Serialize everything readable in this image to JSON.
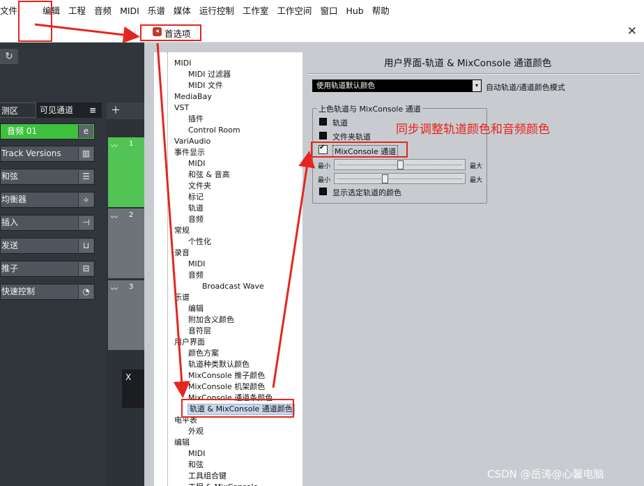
{
  "menubar": {
    "items": [
      "文件",
      "编辑",
      "工程",
      "音频",
      "MIDI",
      "乐谱",
      "媒体",
      "运行控制",
      "工作室",
      "工作空间",
      "窗口",
      "Hub",
      "帮助"
    ]
  },
  "dialog": {
    "title": "首选项",
    "close": "✕"
  },
  "left": {
    "tabs": [
      "测区",
      "可见通道"
    ],
    "track_button": "音频 01",
    "inspector": [
      "Track Versions",
      "和弦",
      "均衡器",
      "插入",
      "发送",
      "推子",
      "快速控制"
    ],
    "track_numbers": [
      "1",
      "2",
      "3"
    ],
    "x_label": "X"
  },
  "tree": [
    {
      "label": "MIDI",
      "level": 1
    },
    {
      "label": "MIDI 过滤器",
      "level": 2
    },
    {
      "label": "MIDI 文件",
      "level": 2
    },
    {
      "label": "MediaBay",
      "level": 1
    },
    {
      "label": "VST",
      "level": 1
    },
    {
      "label": "插件",
      "level": 2
    },
    {
      "label": "Control Room",
      "level": 2
    },
    {
      "label": "VariAudio",
      "level": 1
    },
    {
      "label": "事件显示",
      "level": 1
    },
    {
      "label": "MIDI",
      "level": 2
    },
    {
      "label": "和弦 & 音高",
      "level": 2
    },
    {
      "label": "文件夹",
      "level": 2
    },
    {
      "label": "标记",
      "level": 2
    },
    {
      "label": "轨道",
      "level": 2
    },
    {
      "label": "音频",
      "level": 2
    },
    {
      "label": "常规",
      "level": 1
    },
    {
      "label": "个性化",
      "level": 2
    },
    {
      "label": "录音",
      "level": 1
    },
    {
      "label": "MIDI",
      "level": 2
    },
    {
      "label": "音频",
      "level": 2
    },
    {
      "label": "Broadcast Wave",
      "level": 3
    },
    {
      "label": "乐谱",
      "level": 1
    },
    {
      "label": "编辑",
      "level": 2
    },
    {
      "label": "附加含义颜色",
      "level": 2
    },
    {
      "label": "音符层",
      "level": 2
    },
    {
      "label": "用户界面",
      "level": 1
    },
    {
      "label": "颜色方案",
      "level": 2
    },
    {
      "label": "轨道种类默认颜色",
      "level": 2
    },
    {
      "label": "MixConsole 推子颜色",
      "level": 2
    },
    {
      "label": "MixConsole 机架颜色",
      "level": 2
    },
    {
      "label": "MixConsole 通道条颜色",
      "level": 2
    },
    {
      "label": "轨道 & MixConsole 通道颜色",
      "level": 2,
      "selected": true
    },
    {
      "label": "电平表",
      "level": 1
    },
    {
      "label": "外观",
      "level": 2
    },
    {
      "label": "编辑",
      "level": 1
    },
    {
      "label": "MIDI",
      "level": 2
    },
    {
      "label": "和弦",
      "level": 2
    },
    {
      "label": "工具组合键",
      "level": 2
    },
    {
      "label": "工程 & MixConsole",
      "level": 2
    }
  ],
  "panel": {
    "title": "用户界面-轨道 & MixConsole 通道颜色",
    "dropdown_value": "使用轨道默认颜色",
    "dropdown_desc": "自动轨道/通道颜色模式",
    "group_title": "上色轨道与 MixConsole 通道",
    "checkboxes": [
      {
        "label": "轨道",
        "checked": false
      },
      {
        "label": "文件夹轨道",
        "checked": false
      },
      {
        "label": "MixConsole 通道",
        "checked": true
      }
    ],
    "sliders": [
      {
        "min_label": "最小",
        "max_label": "最大",
        "value": 0.51
      },
      {
        "min_label": "最小",
        "max_label": "最大",
        "value": 0.38
      }
    ],
    "show_selected": {
      "label": "显示选定轨道的颜色",
      "checked": false
    }
  },
  "annotation": "同步调整轨道颜色和音频颜色",
  "watermark": "CSDN @岳涛@心馨电脑",
  "colors": {
    "annotation_red": "#e5251f",
    "track_green": "#3ec13e"
  }
}
